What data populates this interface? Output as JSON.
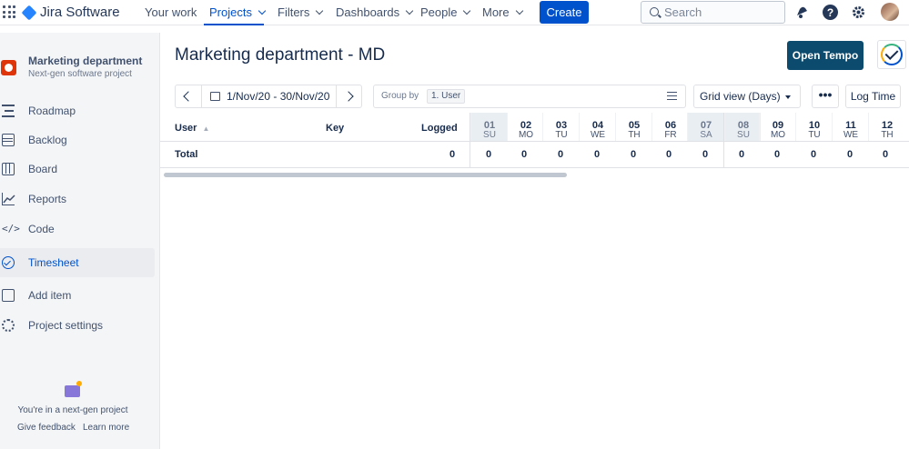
{
  "topnav": {
    "logo_text": "Jira Software",
    "items": [
      {
        "label": "Your work"
      },
      {
        "label": "Projects"
      },
      {
        "label": "Filters"
      },
      {
        "label": "Dashboards"
      },
      {
        "label": "People"
      },
      {
        "label": "More"
      }
    ],
    "create_label": "Create",
    "search_placeholder": "Search",
    "help_glyph": "?"
  },
  "sidebar": {
    "project_name": "Marketing department",
    "project_type": "Next-gen software project",
    "items": [
      {
        "label": "Roadmap",
        "icon": "roadmap-icon"
      },
      {
        "label": "Backlog",
        "icon": "backlog-icon"
      },
      {
        "label": "Board",
        "icon": "board-icon"
      },
      {
        "label": "Reports",
        "icon": "reports-icon"
      },
      {
        "label": "Code",
        "icon": "code-icon"
      },
      {
        "label": "Timesheet",
        "icon": "timesheet-icon"
      },
      {
        "label": "Add item",
        "icon": "add-item-icon"
      },
      {
        "label": "Project settings",
        "icon": "gear-icon"
      }
    ],
    "code_glyph": "</>",
    "nextgen_text": "You're in a next-gen project",
    "give_feedback": "Give feedback",
    "learn_more": "Learn more"
  },
  "main": {
    "title": "Marketing department - MD",
    "open_tempo": "Open Tempo",
    "date_range": "1/Nov/20 - 30/Nov/20",
    "group_by_label": "Group by",
    "group_by_value": "1. User",
    "grid_view": "Grid view (Days)",
    "more_glyph": "•••",
    "log_time": "Log Time"
  },
  "grid": {
    "headers": {
      "user": "User",
      "key": "Key",
      "logged": "Logged"
    },
    "days": [
      {
        "num": "01",
        "name": "SU"
      },
      {
        "num": "02",
        "name": "MO"
      },
      {
        "num": "03",
        "name": "TU"
      },
      {
        "num": "04",
        "name": "WE"
      },
      {
        "num": "05",
        "name": "TH"
      },
      {
        "num": "06",
        "name": "FR"
      },
      {
        "num": "07",
        "name": "SA"
      },
      {
        "num": "08",
        "name": "SU"
      },
      {
        "num": "09",
        "name": "MO"
      },
      {
        "num": "10",
        "name": "TU"
      },
      {
        "num": "11",
        "name": "WE"
      },
      {
        "num": "12",
        "name": "TH"
      }
    ],
    "total_label": "Total",
    "total_logged": "0",
    "day_totals": [
      "0",
      "0",
      "0",
      "0",
      "0",
      "0",
      "0",
      "0",
      "0",
      "0",
      "0",
      "0"
    ]
  },
  "colors": {
    "accent": "#0052cc",
    "tempo": "#0c4a6e",
    "weekend": "#e9eef3"
  }
}
